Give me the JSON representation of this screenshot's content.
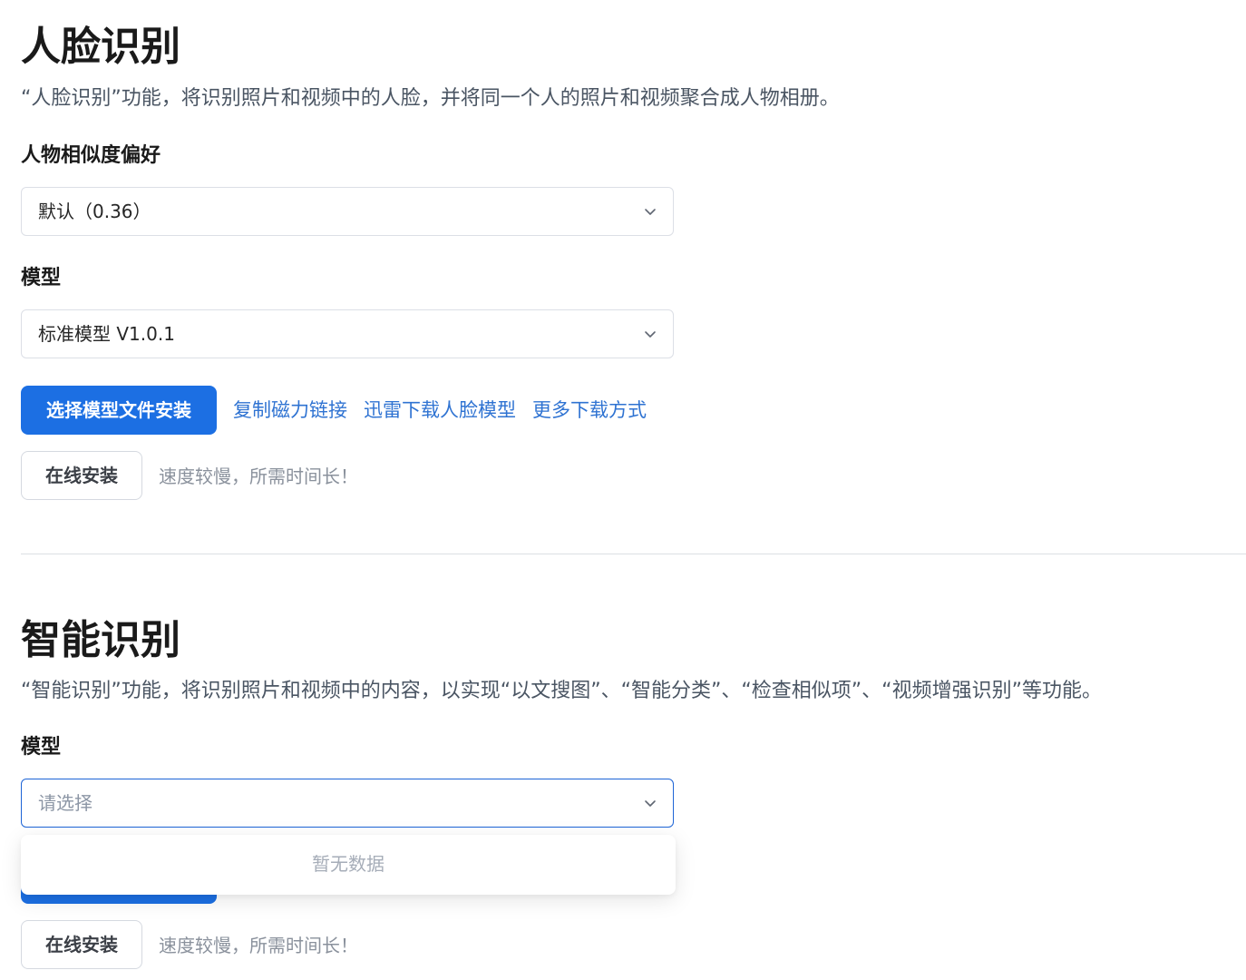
{
  "face": {
    "title": "人脸识别",
    "description": "“人脸识别”功能，将识别照片和视频中的人脸，并将同一个人的照片和视频聚合成人物相册。",
    "similarity_label": "人物相似度偏好",
    "similarity_value": "默认（0.36）",
    "model_label": "模型",
    "model_value": "标准模型 V1.0.1",
    "install_file_button": "选择模型文件安装",
    "links": {
      "copy_magnet": "复制磁力链接",
      "thunder_download": "迅雷下载人脸模型",
      "more_download": "更多下载方式"
    },
    "online_install_button": "在线安装",
    "online_hint": "速度较慢，所需时间长！"
  },
  "smart": {
    "title": "智能识别",
    "description": "“智能识别”功能，将识别照片和视频中的内容，以实现“以文搜图”、“智能分类”、“检查相似项”、“视频增强识别”等功能。",
    "model_label": "模型",
    "model_placeholder": "请选择",
    "dropdown_empty": "暂无数据",
    "online_install_button": "在线安装",
    "online_hint": "速度较慢，所需时间长！"
  },
  "colors": {
    "primary": "#1c6fe3",
    "link": "#2f73d2",
    "focus_border": "#1d64d6"
  },
  "icons": {
    "select_arrow": "chevron-down-icon"
  }
}
